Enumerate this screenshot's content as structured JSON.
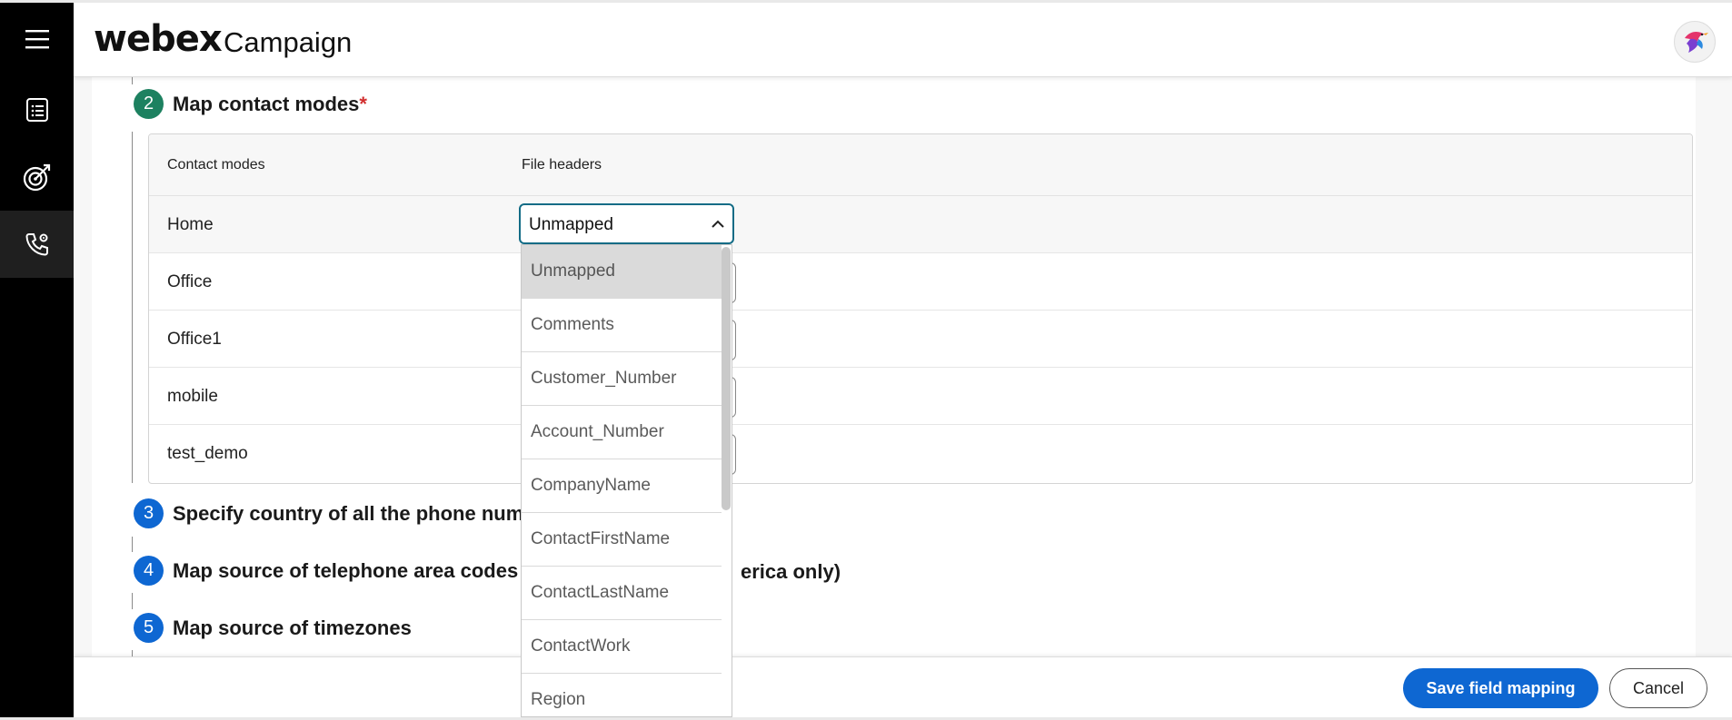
{
  "header": {
    "brand": "webex",
    "app_name": "Campaign"
  },
  "rail": {
    "items": [
      {
        "icon": "menu-icon"
      },
      {
        "icon": "list-icon"
      },
      {
        "icon": "target-icon"
      },
      {
        "icon": "phone-settings-icon"
      }
    ]
  },
  "steps": {
    "step2": {
      "number": "2",
      "title": "Map contact modes",
      "required_mark": "*"
    },
    "step3": {
      "number": "3",
      "title": "Specify country of all the phone numbe"
    },
    "step4": {
      "number": "4",
      "title_start": "Map source of telephone area codes (a",
      "title_end": "erica only)"
    },
    "step5": {
      "number": "5",
      "title": "Map source of timezones"
    }
  },
  "mapping_table": {
    "headers": {
      "contact_modes": "Contact modes",
      "file_headers": "File headers"
    },
    "rows": [
      {
        "mode": "Home",
        "value": "Unmapped"
      },
      {
        "mode": "Office"
      },
      {
        "mode": "Office1"
      },
      {
        "mode": "mobile"
      },
      {
        "mode": "test_demo"
      }
    ]
  },
  "dropdown": {
    "selected": "Unmapped",
    "options": [
      "Unmapped",
      "Comments",
      "Customer_Number",
      "Account_Number",
      "CompanyName",
      "ContactFirstName",
      "ContactLastName",
      "ContactWork",
      "Region"
    ]
  },
  "footer": {
    "save_label": "Save field mapping",
    "cancel_label": "Cancel"
  },
  "colors": {
    "accent": "#0e67d2",
    "step_complete": "#1d8160",
    "required": "#d12e2e",
    "focus_border": "#136c86"
  }
}
